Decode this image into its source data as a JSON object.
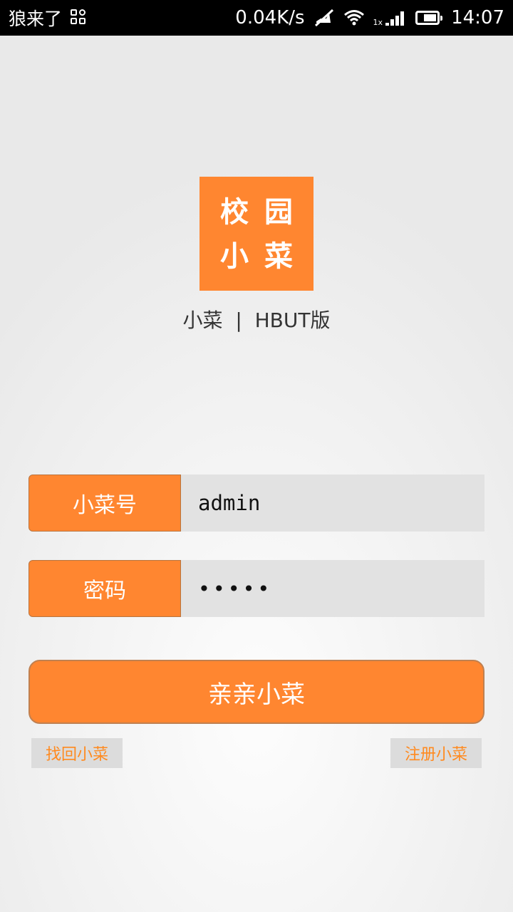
{
  "status_bar": {
    "carrier": "狼来了",
    "net_speed": "0.04K/s",
    "signal_prefix": "1x",
    "time": "14:07",
    "icons": [
      "apps-icon",
      "mute-icon",
      "wifi-icon",
      "signal-icon",
      "battery-icon"
    ]
  },
  "logo": {
    "row1": [
      "校",
      "园"
    ],
    "row2": [
      "小",
      "菜"
    ],
    "subtitle": "小菜  |  HBUT版",
    "color": "#ff8630"
  },
  "form": {
    "username_label": "小菜号",
    "username_value": "admin",
    "password_label": "密码",
    "password_value": "•••••"
  },
  "actions": {
    "login_label": "亲亲小菜",
    "forgot_label": "找回小菜",
    "register_label": "注册小菜"
  },
  "colors": {
    "accent": "#ff8630",
    "link_text": "#ff8a1f",
    "input_bg": "#e2e2e2"
  }
}
